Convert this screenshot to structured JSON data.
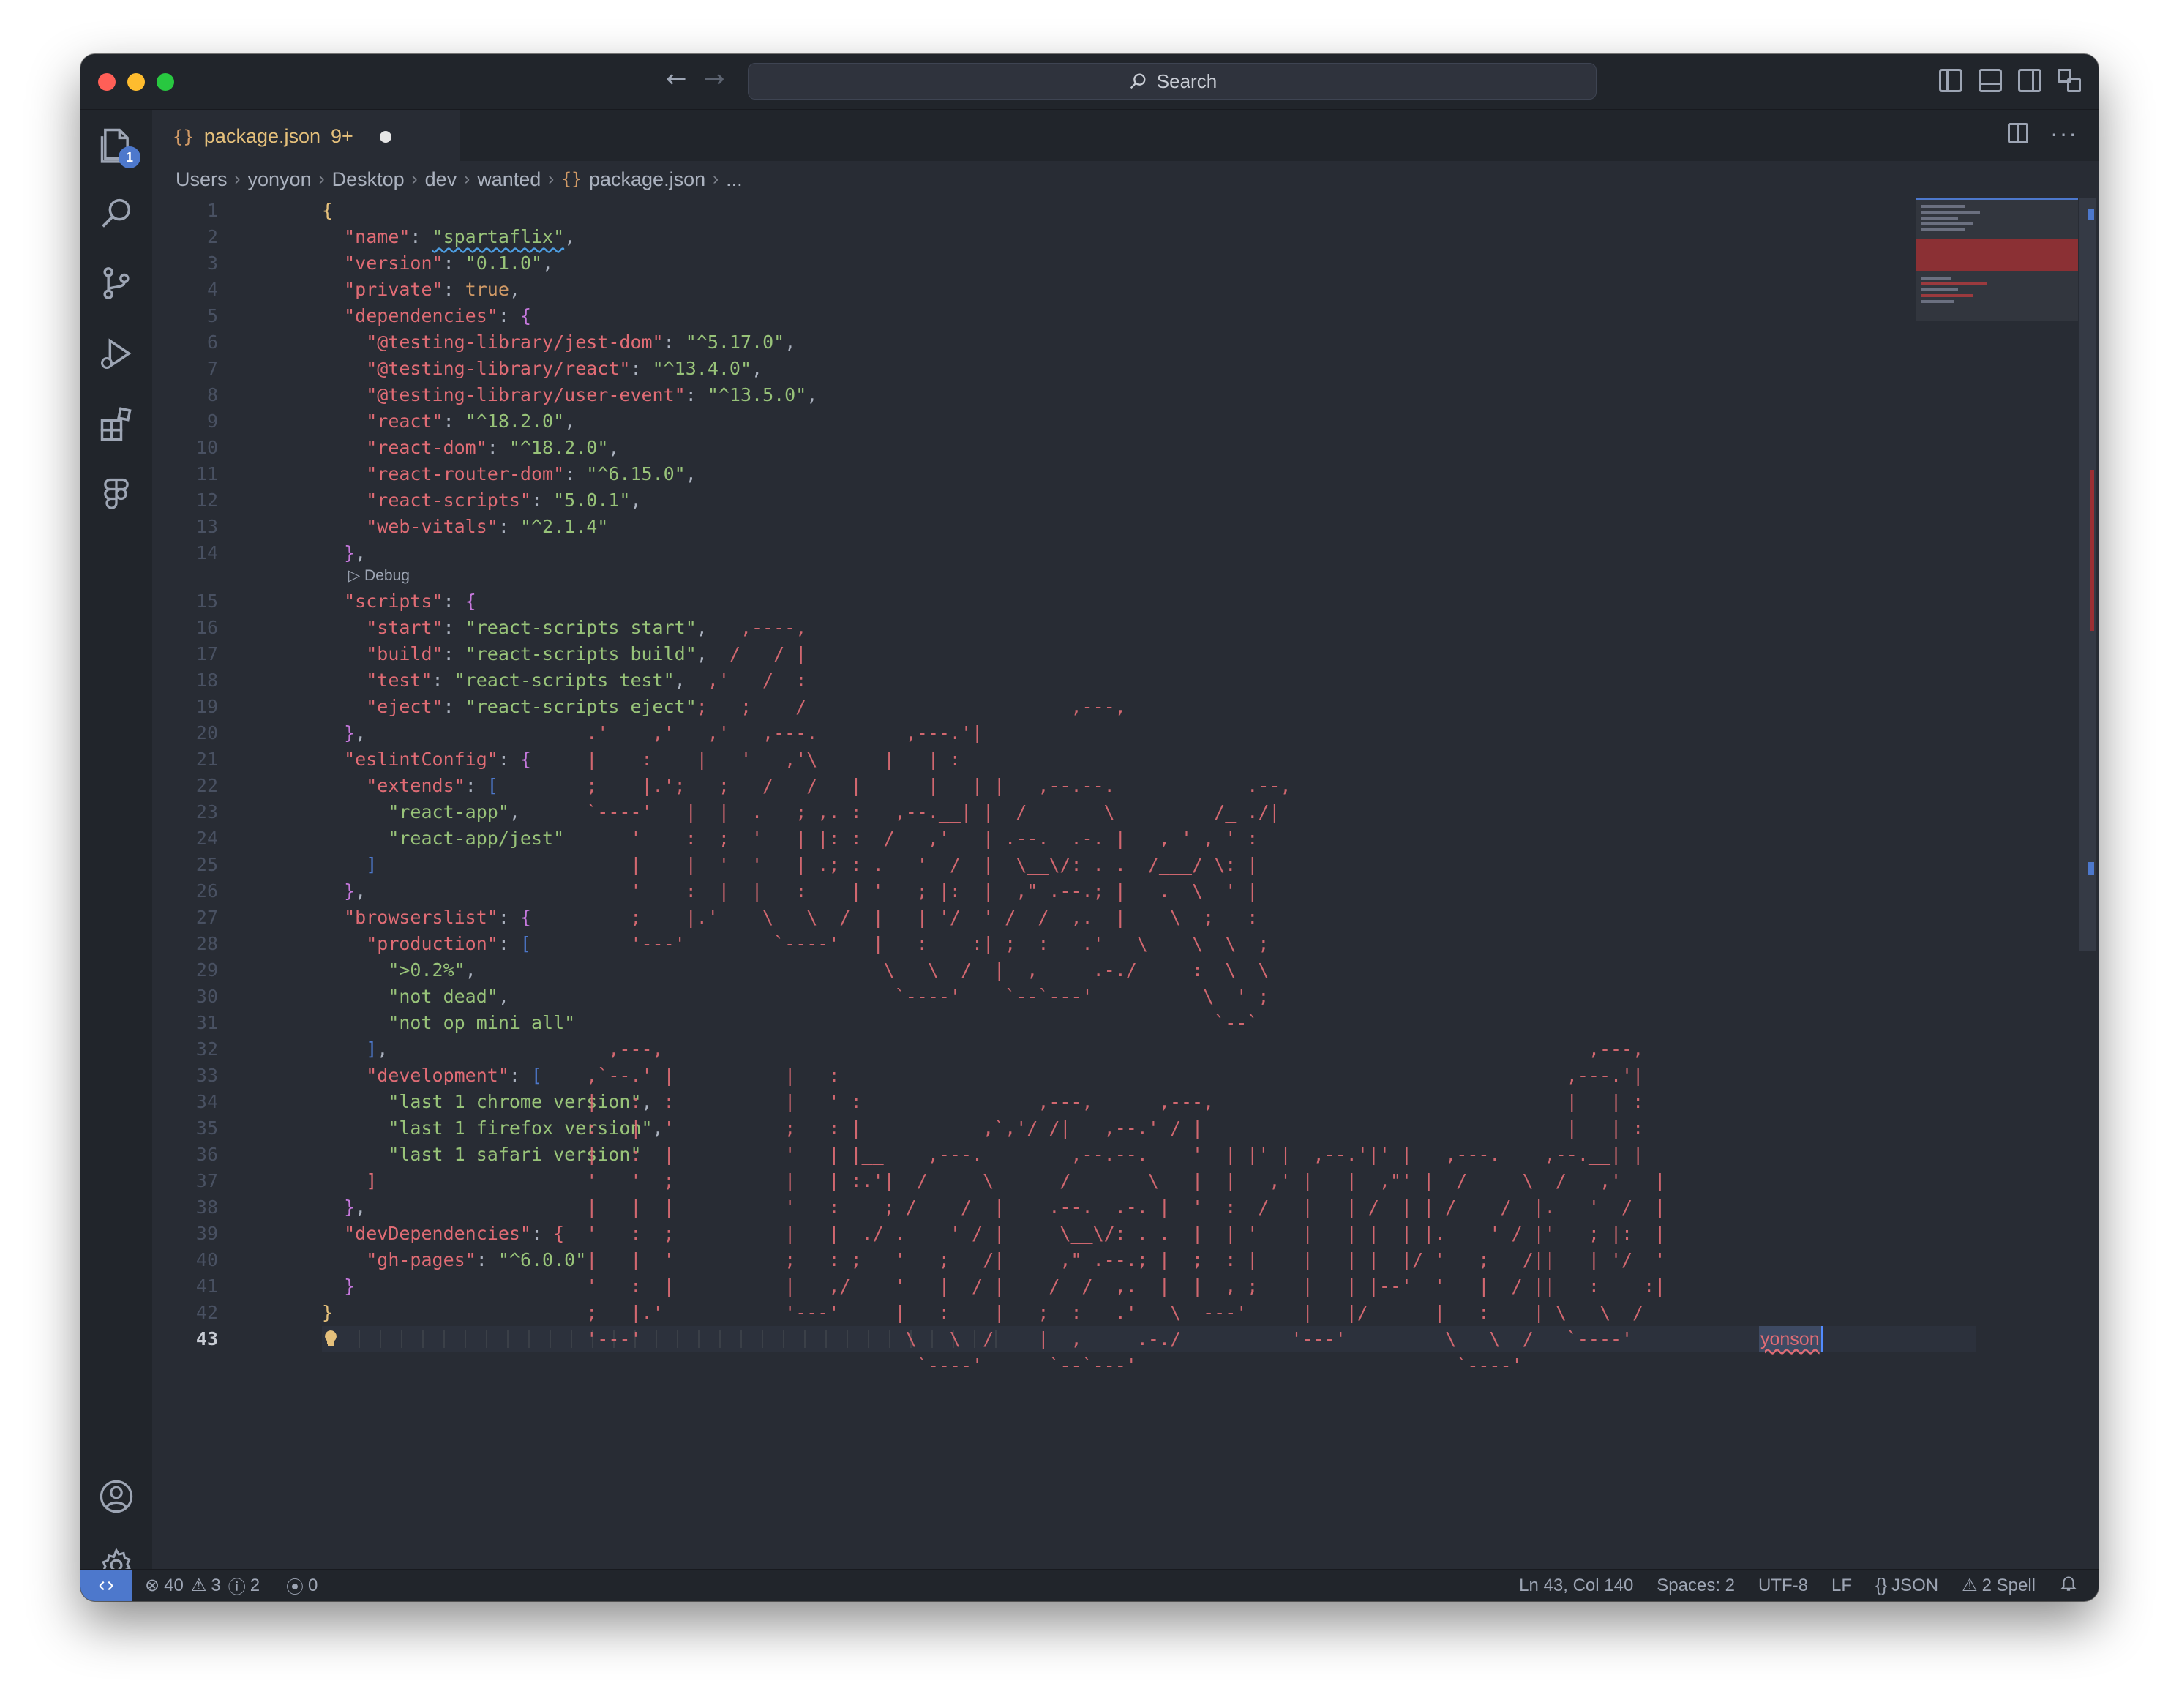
{
  "titlebar": {
    "search_placeholder": "Search"
  },
  "activity": {
    "explorer_badge": "1"
  },
  "tab": {
    "icon_text": "{}",
    "filename": "package.json",
    "problem_count": "9+"
  },
  "breadcrumb": {
    "parts": [
      "Users",
      "yonyon",
      "Desktop",
      "dev",
      "wanted"
    ],
    "file_icon": "{}",
    "file": "package.json",
    "ellipsis": "..."
  },
  "editor": {
    "line_numbers": [
      "1",
      "2",
      "3",
      "4",
      "5",
      "6",
      "7",
      "8",
      "9",
      "10",
      "11",
      "12",
      "13",
      "14",
      "15",
      "16",
      "17",
      "18",
      "19",
      "20",
      "21",
      "22",
      "23",
      "24",
      "25",
      "26",
      "27",
      "28",
      "29",
      "30",
      "31",
      "32",
      "33",
      "34",
      "35",
      "36",
      "37",
      "38",
      "39",
      "40",
      "41",
      "42",
      "43"
    ],
    "active_line": "43",
    "debug_lens": "Debug",
    "code": {
      "name_key": "\"name\"",
      "name_val": "\"spartaflix\"",
      "version_key": "\"version\"",
      "version_val": "\"0.1.0\"",
      "private_key": "\"private\"",
      "private_val": "true",
      "dependencies_key": "\"dependencies\"",
      "deps": [
        {
          "k": "\"@testing-library/jest-dom\"",
          "v": "\"^5.17.0\""
        },
        {
          "k": "\"@testing-library/react\"",
          "v": "\"^13.4.0\""
        },
        {
          "k": "\"@testing-library/user-event\"",
          "v": "\"^13.5.0\""
        },
        {
          "k": "\"react\"",
          "v": "\"^18.2.0\""
        },
        {
          "k": "\"react-dom\"",
          "v": "\"^18.2.0\""
        },
        {
          "k": "\"react-router-dom\"",
          "v": "\"^6.15.0\""
        },
        {
          "k": "\"react-scripts\"",
          "v": "\"5.0.1\""
        },
        {
          "k": "\"web-vitals\"",
          "v": "\"^2.1.4\""
        }
      ],
      "scripts_key": "\"scripts\"",
      "scripts": [
        {
          "k": "\"start\"",
          "v": "\"react-scripts start\""
        },
        {
          "k": "\"build\"",
          "v": "\"react-scripts build\""
        },
        {
          "k": "\"test\"",
          "v": "\"react-scripts test\""
        },
        {
          "k": "\"eject\"",
          "v": "\"react-scripts eject\""
        }
      ],
      "eslint_key": "\"eslintConfig\"",
      "extends_key": "\"extends\"",
      "extends": [
        "\"react-app\"",
        "\"react-app/jest\""
      ],
      "browserslist_key": "\"browserslist\"",
      "production_key": "\"production\"",
      "production": [
        "\">0.2%\"",
        "\"not dead\"",
        "\"not op_mini all\""
      ],
      "development_key": "\"development\"",
      "development": [
        "\"last 1 chrome version\"",
        "\"last 1 firefox version\"",
        "\"last 1 safari version\""
      ],
      "devdeps_key": "\"devDependencies\"",
      "ghpages_key": "\"gh-pages\"",
      "ghpages_val": "\"^6.0.0\"",
      "cursor_word": "yonson"
    },
    "ascii_art": [
      "                                      ,----,",
      "                                     /   / |",
      "                                   ,'   /  :",
      "                                  ;   ;    /                        ,---,",
      "                        .'____,'   ,'   ,---.        ,---.'|",
      "                        |    :    |   '   ,'\\      |   | :",
      "                        ;    |.';   ;   /   /   |      |   | |   ,--.--.            .--,",
      "                        `----'   |  |  .   ; ,. :   ,--.__| |  /       \\         /_ ./|",
      "                            '    :  ;  '   | |: :  /   ,'   | .--.  .-. |   , ' , ' :",
      "                            |    |  '  '   | .; : .   '  /  |  \\__\\/: . .  /___/ \\: |",
      "                            '    :  |  |   :    | '   ; |:  |  ,\" .--.; |   .  \\  ' |",
      "                            ;    |.'    \\   \\  /  |   | '/  ' /  /  ,.  |    \\  ;   :",
      "                            '---'        `----'   |   :    :| ;  :   .'   \\    \\  \\  ;",
      "                                                   \\   \\  /  |  ,     .-./     :  \\  \\",
      "                                                    `----'    `--`---'          \\  ' ;",
      "                                                                                 `--`",
      "                          ,---,                                                                                    ,---,",
      "                        ,`--.' |          |   :                                                                  ,---.'|",
      "                        |   :  :          |   ' :                ,---,      ,---,                                |   | :",
      "                        :   |  '          ;   : |           ,`,'/ /|   ,--.' / |                                 |   | :",
      "                        |   :  |          '   | |__    ,---.        ,--.--.    '  | |' |  ,--.'|' |   ,---.    ,--.__| |",
      "                        '   '  ;          |   | :.'|  /     \\      /       \\   |  |   ,' |   |  ,\"' |  /     \\  /   ,'   |",
      "                        |   |  |          '   :    ; /    /  |    .--.  .-. |  '  :  /   |   | /  | | /    /  |.   '  /  |",
      "                        '   :  ;          |   |  ./ .    ' / |     \\__\\/: . .  |  | '    |   | |  | |.    ' / |'   ; |:  |",
      "                        |   |  '          ;   : ;   '   ;   /|     ,\" .--.; |  ;  : |    |   | |  |/ '   ;   /||   | '/  '",
      "                        '   :  |          |   ,/    '   |  / |    /  /  ,.  |  |  , ;    |   | |--'  '   |  / ||   :    :|",
      "                        ;   |.'           '---'     |   :    |   ;  :   .'   \\  ---'     |   |/      |   :    | \\   \\  /",
      "                        '---'                        \\   \\  /    |  ,     .-./          '---'         \\   \\  /   `----'",
      "                                                      `----'      `--`---'                             `----'"
    ]
  },
  "status": {
    "errors": "40",
    "warnings": "3",
    "infos": "2",
    "ports": "0",
    "position": "Ln 43, Col 140",
    "spaces": "Spaces: 2",
    "encoding": "UTF-8",
    "eol": "LF",
    "lang_icon": "{}",
    "language": "JSON",
    "spell": "2 Spell"
  }
}
